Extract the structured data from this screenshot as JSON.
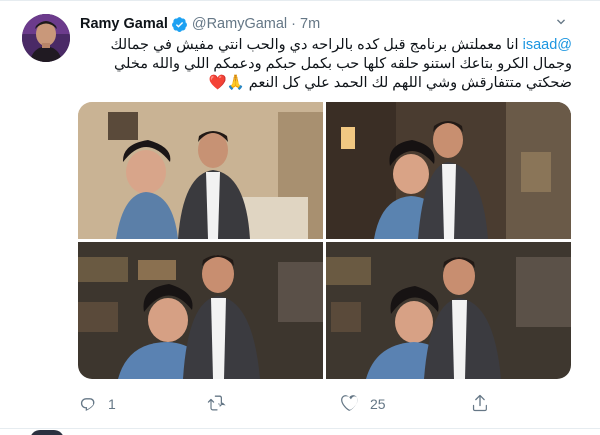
{
  "tweet": {
    "author": {
      "name": "Ramy Gamal",
      "handle": "@RamyGamal",
      "verified": true
    },
    "time": "7m",
    "mention": "@isaad",
    "text": "انا معملتش برنامج قبل كده بالراحه دي والحب انتي مفيش في جمالك وجمال الكرو بتاعك استنو حلقه كلها حب بكمل حبكم ودعمكم اللي والله مخلي ضحكتي متتفارقش وشي اللهم لك الحمد علي كل النعم 🙏❤️",
    "stats": {
      "replies": "1",
      "retweets": "",
      "likes": "25"
    },
    "photo_count": 4
  },
  "icons": {
    "verified": "verified-badge-icon",
    "caret": "chevron-down-icon",
    "reply": "reply-icon",
    "retweet": "retweet-icon",
    "like": "heart-icon",
    "share": "share-icon"
  },
  "colors": {
    "link": "#1b95e0",
    "muted": "#657786",
    "verified": "#1da1f2",
    "divider": "#e6ecf0"
  }
}
